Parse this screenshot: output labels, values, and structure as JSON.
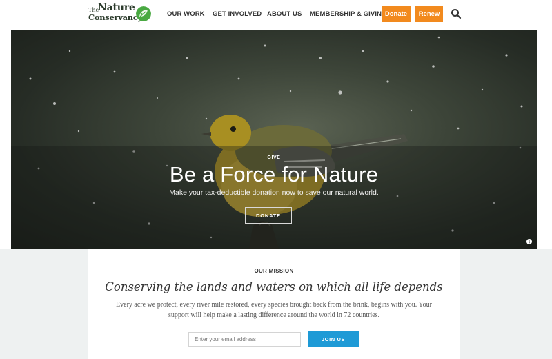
{
  "header": {
    "logo": {
      "line1": "The",
      "line2": "Nature",
      "line3": "Conservancy",
      "leaf_color": "#49a942"
    },
    "nav": [
      {
        "label": "OUR WORK"
      },
      {
        "label": "GET INVOLVED"
      },
      {
        "label": "ABOUT US"
      },
      {
        "label": "MEMBERSHIP & GIVING"
      }
    ],
    "donate_label": "Donate",
    "renew_label": "Renew",
    "search_icon": "search-icon",
    "accent_orange": "#f28a1e"
  },
  "hero": {
    "kicker": "GIVE",
    "title": "Be a Force for Nature",
    "subtitle": "Make your tax-deductible donation now to save our natural world.",
    "button_label": "DONATE",
    "info_icon": "info-icon"
  },
  "mission": {
    "label": "OUR MISSION",
    "title": "Conserving the lands and waters on which all life depends",
    "body": "Every acre we protect, every river mile restored, every species brought back from the brink, begins with you. Your support will help make a lasting difference around the world in 72 countries.",
    "email_placeholder": "Enter your email address",
    "join_label": "JOIN US",
    "accent_blue": "#1e9ad6"
  }
}
